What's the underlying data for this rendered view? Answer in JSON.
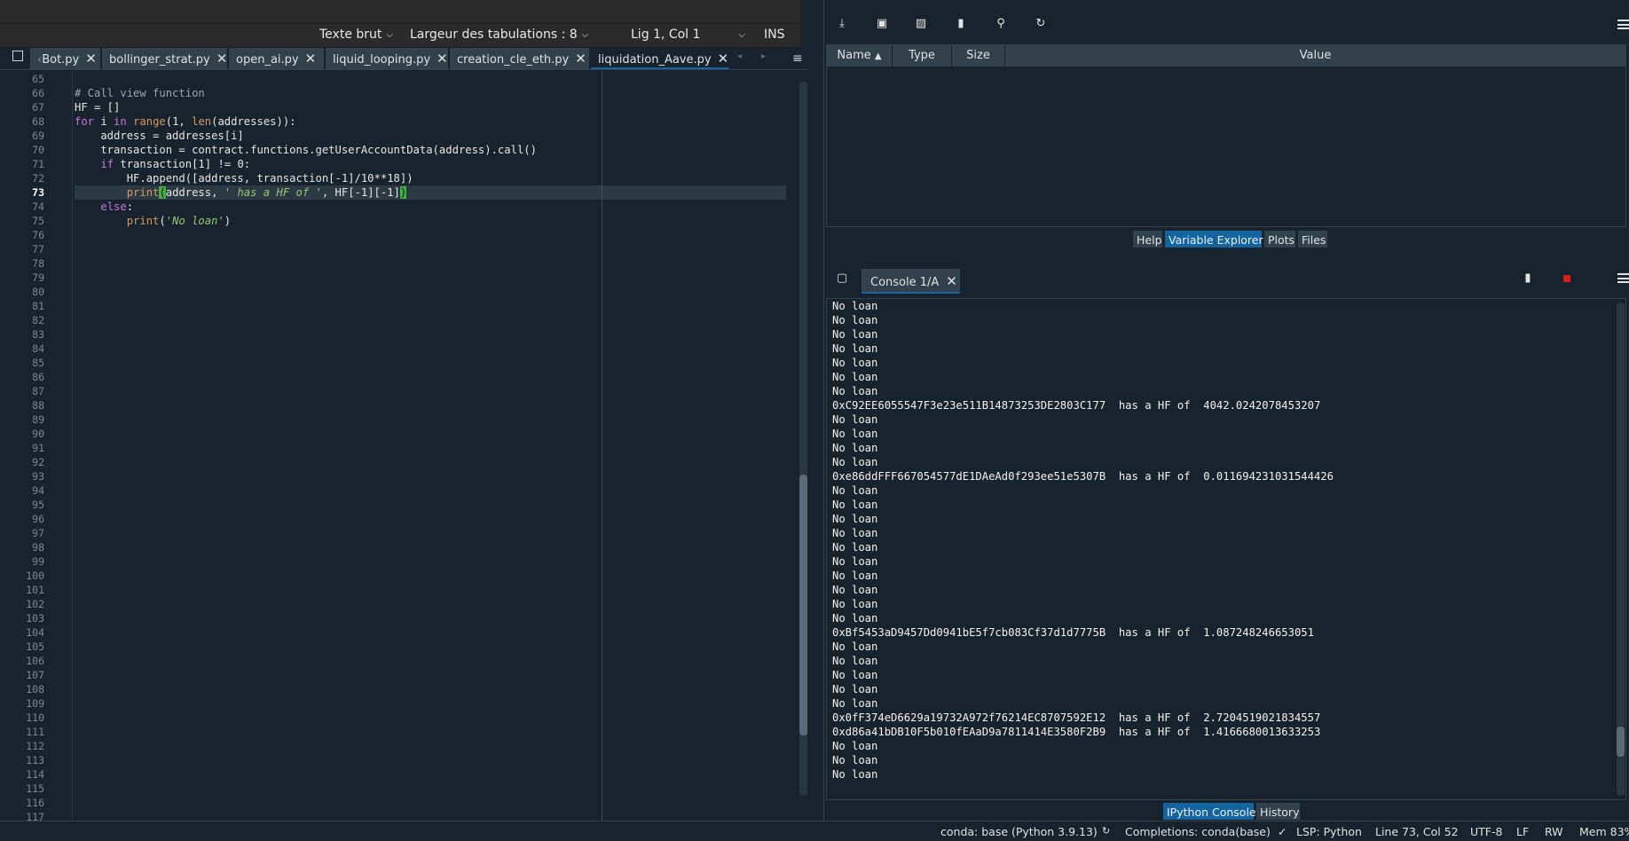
{
  "top_bar": {
    "syntax_mode": "Texte brut",
    "tab_width": "Largeur des tabulations : 8",
    "cursor_position": "Lig 1, Col 1",
    "insert_mode": "INS"
  },
  "editor_tabs": [
    {
      "label": "Bot.py",
      "active": false
    },
    {
      "label": "bollinger_strat.py",
      "active": false
    },
    {
      "label": "open_ai.py",
      "active": false
    },
    {
      "label": "liquid_looping.py",
      "active": false
    },
    {
      "label": "creation_cle_eth.py",
      "active": false
    },
    {
      "label": "liquidation_Aave.py",
      "active": true
    }
  ],
  "editor": {
    "line_numbers": [
      "65",
      "66",
      "67",
      "68",
      "69",
      "70",
      "71",
      "72",
      "73",
      "74",
      "75",
      "76",
      "77",
      "78",
      "79",
      "80",
      "81",
      "82",
      "83",
      "84",
      "85",
      "86",
      "87",
      "88",
      "89",
      "90",
      "91",
      "92",
      "93",
      "94",
      "95",
      "96",
      "97",
      "98",
      "99",
      "100",
      "101",
      "102",
      "103",
      "104",
      "105",
      "106",
      "107",
      "108",
      "109",
      "110",
      "111",
      "112",
      "113",
      "114",
      "115",
      "116",
      "117"
    ],
    "current_line": "73",
    "code": {
      "l66": "# Call view function",
      "l67": "HF = []",
      "l68_kw": "for",
      "l68_a": " i ",
      "l68_kw2": "in",
      "l68_b": " ",
      "l68_bi": "range",
      "l68_c": "(1, ",
      "l68_bi2": "len",
      "l68_d": "(addresses)):",
      "l69": "    address = addresses[i]",
      "l70": "    transaction = contract.functions.getUserAccountData(address).call()",
      "l71_indent": "    ",
      "l71_kw": "if",
      "l71_rest": " transaction[1] != 0:",
      "l72": "        HF.append([address, transaction[-1]/10**18])",
      "l73_indent": "        ",
      "l73_bi": "print",
      "l73_open": "(",
      "l73_a": "address, ",
      "l73_str": "' has a HF of '",
      "l73_b": ", HF[-1][-1]",
      "l73_close": ")",
      "l74_indent": "    ",
      "l74_kw": "else",
      "l74_rest": ":",
      "l75_indent": "        ",
      "l75_bi": "print",
      "l75_a": "(",
      "l75_str": "'No loan'",
      "l75_b": ")"
    }
  },
  "variable_explorer": {
    "columns": [
      "Name",
      "Type",
      "Size",
      "Value"
    ],
    "sort_indicator": "▲"
  },
  "pane_tabs_top": [
    "Help",
    "Variable Explorer",
    "Plots",
    "Files"
  ],
  "pane_tabs_top_active": "Variable Explorer",
  "console": {
    "tab_label": "Console 1/A",
    "lines": [
      "No loan",
      "No loan",
      "No loan",
      "No loan",
      "No loan",
      "No loan",
      "No loan",
      "0xC92EE6055547F3e23e511B14873253DE2803C177  has a HF of  4042.0242078453207",
      "No loan",
      "No loan",
      "No loan",
      "No loan",
      "0xe86ddFFF667054577dE1DAeAd0f293ee51e5307B  has a HF of  0.011694231031544426",
      "No loan",
      "No loan",
      "No loan",
      "No loan",
      "No loan",
      "No loan",
      "No loan",
      "No loan",
      "No loan",
      "No loan",
      "0xBf5453aD9457Dd0941bE5f7cb083Cf37d1d7775B  has a HF of  1.087248246653051",
      "No loan",
      "No loan",
      "No loan",
      "No loan",
      "No loan",
      "0x0fF374eD6629a19732A972f76214EC8707592E12  has a HF of  2.7204519021834557",
      "0xd86a41bDB10F5b010fEAaD9a7811414E3580F2B9  has a HF of  1.4166680013633253",
      "No loan",
      "No loan",
      "No loan"
    ]
  },
  "pane_tabs_bottom": [
    "IPython Console",
    "History"
  ],
  "pane_tabs_bottom_active": "IPython Console",
  "status_bar": {
    "env": "conda: base (Python 3.9.13)",
    "completions": "Completions: conda(base)",
    "lsp": "LSP: Python",
    "position": "Line 73, Col 52",
    "encoding": "UTF-8",
    "eol": "LF",
    "rw": "RW",
    "mem": "Mem 83%"
  },
  "colors": {
    "background": "#19232d",
    "panel": "#32414b",
    "accent": "#1464a0",
    "bracket_match": "#3db33d",
    "stop_red": "#d41f1f"
  }
}
